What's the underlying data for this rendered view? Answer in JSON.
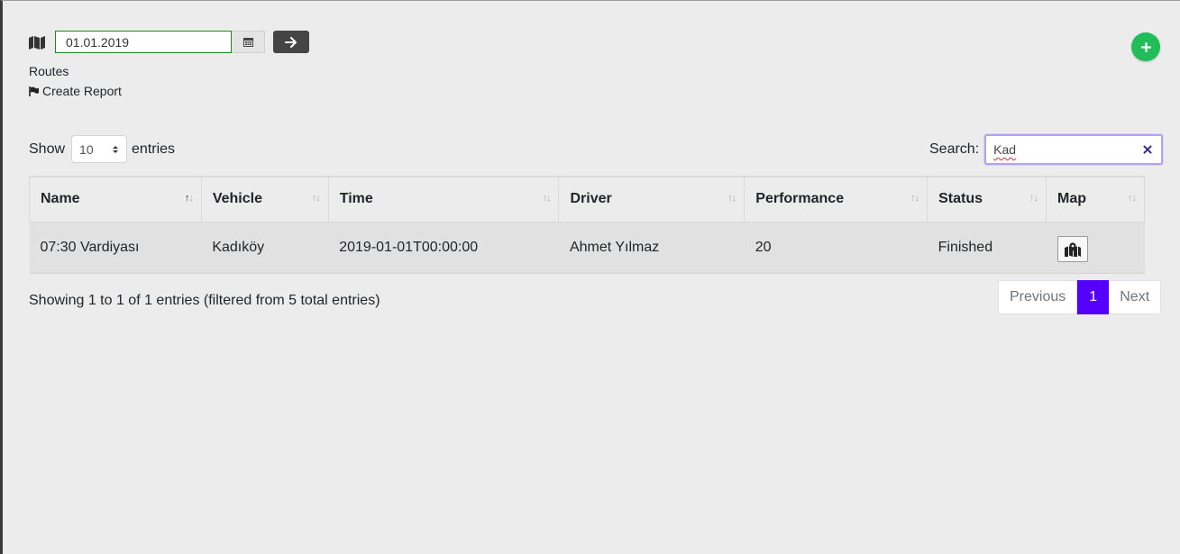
{
  "toolbar": {
    "date_value": "01.01.2019",
    "icons": [
      "map-icon",
      "calendar-icon",
      "arrow-right-icon",
      "plus-icon"
    ]
  },
  "links": {
    "routes": "Routes",
    "create_report": "Create Report"
  },
  "length": {
    "show": "Show",
    "value": "10",
    "entries": "entries"
  },
  "search": {
    "label": "Search:",
    "value": "Kad"
  },
  "table": {
    "columns": [
      "Name",
      "Vehicle",
      "Time",
      "Driver",
      "Performance",
      "Status",
      "Map"
    ],
    "sorted_column": "Name",
    "rows": [
      {
        "name": "07:30 Vardiyası",
        "vehicle": "Kadıköy",
        "time": "2019-01-01T00:00:00",
        "driver": "Ahmet Yılmaz",
        "performance": "20",
        "status": "Finished"
      }
    ]
  },
  "info": "Showing 1 to 1 of 1 entries (filtered from 5 total entries)",
  "pagination": {
    "previous": "Previous",
    "current": "1",
    "next": "Next"
  },
  "colors": {
    "accent": "#5500ff",
    "add_button": "#21bd5a",
    "go_button": "#454545",
    "date_border": "#1a8a1a"
  }
}
